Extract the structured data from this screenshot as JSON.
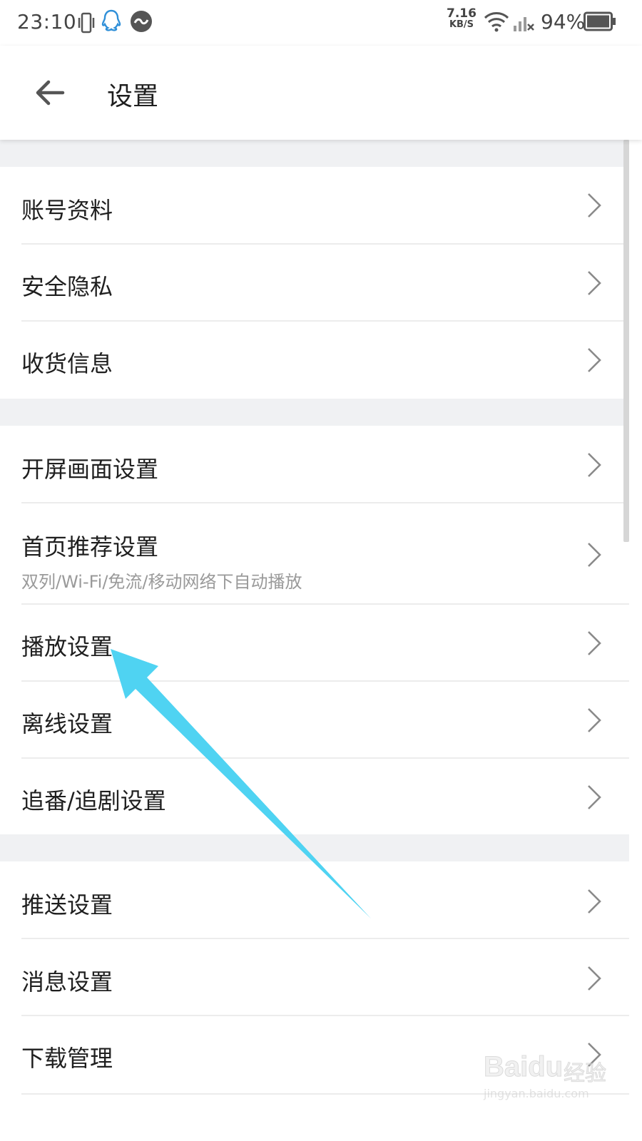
{
  "status_bar": {
    "time": "23:10",
    "net_speed_value": "7.16",
    "net_speed_unit": "KB/S",
    "battery": "94%"
  },
  "header": {
    "title": "设置"
  },
  "groups": [
    {
      "items": [
        {
          "label": "账号资料"
        },
        {
          "label": "安全隐私"
        },
        {
          "label": "收货信息"
        }
      ]
    },
    {
      "items": [
        {
          "label": "开屏画面设置"
        },
        {
          "label": "首页推荐设置",
          "sub": "双列/Wi-Fi/免流/移动网络下自动播放"
        },
        {
          "label": "播放设置"
        },
        {
          "label": "离线设置"
        },
        {
          "label": "追番/追剧设置"
        }
      ]
    },
    {
      "items": [
        {
          "label": "推送设置"
        },
        {
          "label": "消息设置"
        },
        {
          "label": "下载管理"
        }
      ]
    }
  ],
  "annotation": {
    "color": "#4fd3f2"
  },
  "watermark": {
    "brand": "Baidu",
    "suffix": "经验",
    "url": "jingyan.baidu.com"
  },
  "icons": [
    "vibrate-icon",
    "qq-icon",
    "app-icon",
    "wifi-icon",
    "signal-icon",
    "battery-icon",
    "back-arrow-icon",
    "chevron-right-icon"
  ]
}
